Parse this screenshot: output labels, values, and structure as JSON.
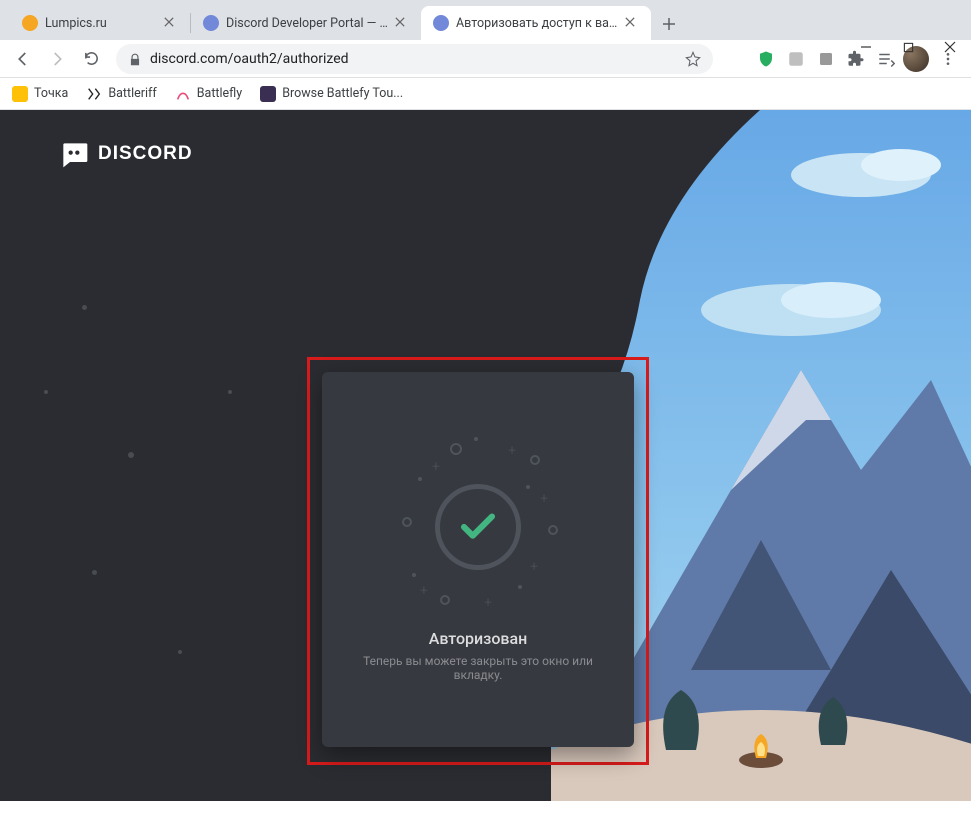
{
  "window": {
    "tabs": [
      {
        "title": "Lumpics.ru",
        "favicon_color": "#f5a623",
        "active": false
      },
      {
        "title": "Discord Developer Portal — M",
        "favicon_color": "#7289da",
        "active": false
      },
      {
        "title": "Авторизовать доступ к ваше",
        "favicon_color": "#7289da",
        "active": true
      }
    ]
  },
  "addressbar": {
    "url_display": "discord.com/oauth2/authorized"
  },
  "bookmarks": [
    {
      "label": "Точка",
      "icon_color": "#ffc107"
    },
    {
      "label": "Battleriff",
      "icon_color": "#222"
    },
    {
      "label": "Battlefly",
      "icon_color": "#e84c7a"
    },
    {
      "label": "Browse Battlefy Tou...",
      "icon_color": "#3a2e52"
    }
  ],
  "discord": {
    "brand": "DISCORD",
    "card": {
      "title": "Авторизован",
      "subtitle": "Теперь вы можете закрыть это окно или вкладку."
    }
  }
}
